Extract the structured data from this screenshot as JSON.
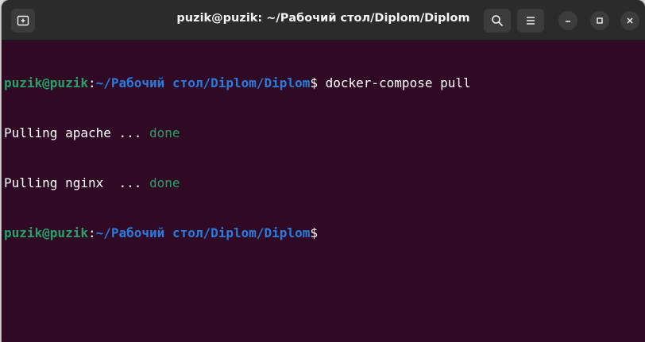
{
  "window": {
    "title": "puzik@puzik: ~/Рабочий стол/Diplom/Diplom"
  },
  "buttons": {
    "new_tab_icon": "new-tab-icon",
    "search_icon": "search-icon",
    "menu_icon": "hamburger-menu-icon",
    "minimize_icon": "minimize-icon",
    "maximize_icon": "maximize-icon",
    "close_icon": "close-icon"
  },
  "terminal": {
    "prompt_user": "puzik@puzik",
    "prompt_sep": ":",
    "prompt_path": "~/Рабочий стол/Diplom/Diplom",
    "prompt_symbol": "$",
    "command": " docker-compose pull",
    "lines": [
      {
        "text": "Pulling apache ... ",
        "status": "done"
      },
      {
        "text": "Pulling nginx  ... ",
        "status": "done"
      }
    ]
  },
  "colors": {
    "background": "#300a24",
    "user": "#26a269",
    "path": "#2a7bde",
    "status": "#26a269"
  }
}
